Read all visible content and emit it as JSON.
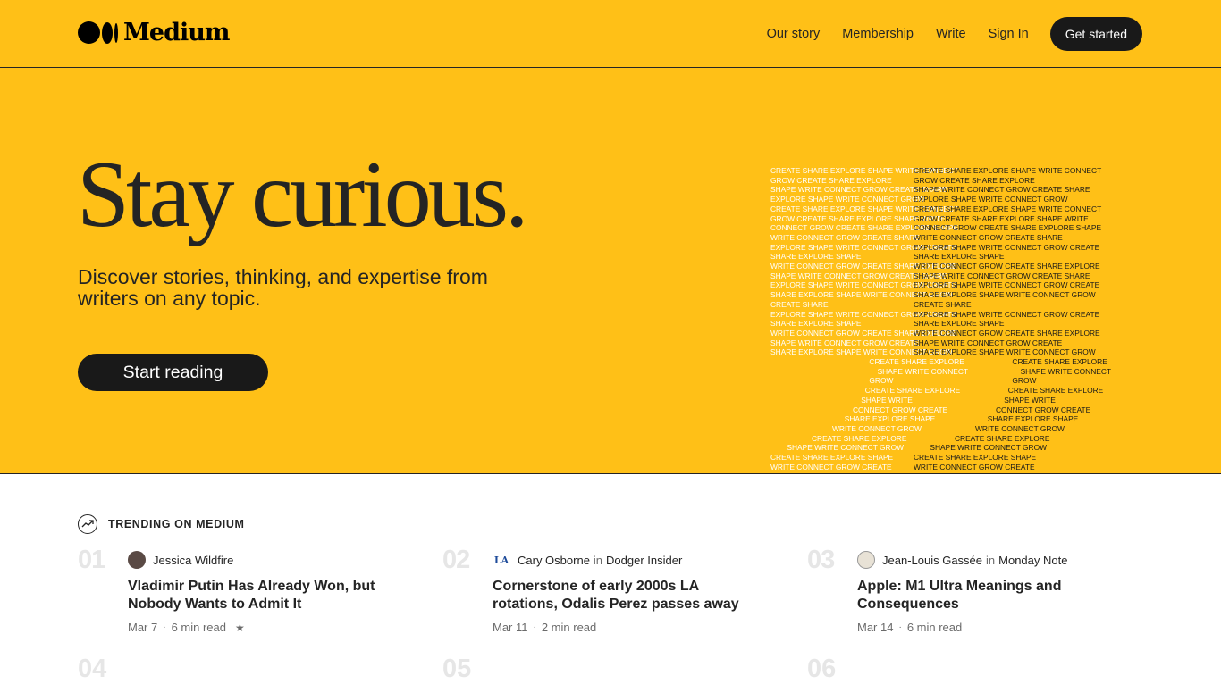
{
  "header": {
    "logo_text": "Medium",
    "nav": [
      "Our story",
      "Membership",
      "Write",
      "Sign In"
    ],
    "cta": "Get started"
  },
  "hero": {
    "title": "Stay curious.",
    "subtitle": "Discover stories, thinking, and expertise from writers on any topic.",
    "button": "Start reading",
    "background": "#FFC017"
  },
  "art": {
    "left": [
      "CREATE SHARE EXPLORE SHAPE WRITE CONNECT",
      "GROW CREATE SHARE EXPLORE",
      "SHAPE WRITE CONNECT GROW CREATE SHARE",
      "EXPLORE SHAPE WRITE CONNECT GROW",
      "CREATE SHARE EXPLORE SHAPE WRITE CONNECT",
      "GROW CREATE SHARE EXPLORE SHAPE WRITE",
      "CONNECT GROW CREATE SHARE EXPLORE SHAPE",
      "WRITE CONNECT GROW CREATE SHARE",
      "EXPLORE SHAPE WRITE CONNECT GROW CREATE",
      "SHARE EXPLORE SHAPE",
      "WRITE CONNECT GROW CREATE SHARE EXPLORE",
      "SHAPE WRITE CONNECT GROW CREATE SHARE",
      "EXPLORE SHAPE WRITE CONNECT GROW CREATE",
      "SHARE EXPLORE SHAPE WRITE CONNECT GROW",
      "CREATE SHARE",
      "EXPLORE SHAPE WRITE CONNECT GROW CREATE",
      "SHARE EXPLORE SHAPE",
      "WRITE CONNECT GROW CREATE SHARE EXPLORE",
      "SHAPE WRITE CONNECT GROW CREATE",
      "SHARE EXPLORE SHAPE WRITE CONNECT GROW",
      "                        CREATE SHARE EXPLORE",
      "                          SHAPE WRITE CONNECT",
      "                        GROW",
      "                       CREATE SHARE EXPLORE",
      "                      SHAPE WRITE",
      "                    CONNECT GROW CREATE",
      "                  SHARE EXPLORE SHAPE",
      "               WRITE CONNECT GROW",
      "          CREATE SHARE EXPLORE",
      "    SHAPE WRITE CONNECT GROW",
      "CREATE SHARE EXPLORE SHAPE",
      "WRITE CONNECT GROW CREATE"
    ],
    "right": [
      "CREATE SHARE EXPLORE SHAPE WRITE CONNECT",
      "GROW CREATE SHARE EXPLORE",
      "SHAPE WRITE CONNECT GROW CREATE SHARE",
      "EXPLORE SHAPE WRITE CONNECT GROW",
      "CREATE SHARE EXPLORE SHAPE WRITE CONNECT",
      "GROW CREATE SHARE EXPLORE SHAPE WRITE",
      "CONNECT GROW CREATE SHARE EXPLORE SHAPE",
      "WRITE CONNECT GROW CREATE SHARE",
      "EXPLORE SHAPE WRITE CONNECT GROW CREATE",
      "SHARE EXPLORE SHAPE",
      "WRITE CONNECT GROW CREATE SHARE EXPLORE",
      "SHAPE WRITE CONNECT GROW CREATE SHARE",
      "EXPLORE SHAPE WRITE CONNECT GROW CREATE",
      "SHARE EXPLORE SHAPE WRITE CONNECT GROW",
      "CREATE SHARE",
      "EXPLORE SHAPE WRITE CONNECT GROW CREATE",
      "SHARE EXPLORE SHAPE",
      "WRITE CONNECT GROW CREATE SHARE EXPLORE",
      "SHAPE WRITE CONNECT GROW CREATE",
      "SHARE EXPLORE SHAPE WRITE CONNECT GROW",
      "                        CREATE SHARE EXPLORE",
      "                          SHAPE WRITE CONNECT",
      "                        GROW",
      "                       CREATE SHARE EXPLORE",
      "                      SHAPE WRITE",
      "                    CONNECT GROW CREATE",
      "                  SHARE EXPLORE SHAPE",
      "               WRITE CONNECT GROW",
      "          CREATE SHARE EXPLORE",
      "    SHAPE WRITE CONNECT GROW",
      "CREATE SHARE EXPLORE SHAPE",
      "WRITE CONNECT GROW CREATE"
    ]
  },
  "trending": {
    "label": "TRENDING ON MEDIUM",
    "items": [
      {
        "num": "01",
        "author": "Jessica Wildfire",
        "in": "",
        "publication": "",
        "avatar_color": "#5a4a45",
        "title": "Vladimir Putin Has Already Won, but Nobody Wants to Admit It",
        "date": "Mar 7",
        "read": "6 min read",
        "star": "★"
      },
      {
        "num": "02",
        "author": "Cary Osborne",
        "in": "in",
        "publication": "Dodger Insider",
        "avatar_color": "#1e4b9a",
        "title": "Cornerstone of early 2000s LA rotations, Odalis Perez passes away",
        "date": "Mar 11",
        "read": "2 min read",
        "star": ""
      },
      {
        "num": "03",
        "author": "Jean-Louis Gassée",
        "in": "in",
        "publication": "Monday Note",
        "avatar_color": "#d9d2c3",
        "title": "Apple: M1 Ultra Meanings and Consequences",
        "date": "Mar 14",
        "read": "6 min read",
        "star": ""
      }
    ],
    "next_nums": [
      "04",
      "05",
      "06"
    ]
  }
}
